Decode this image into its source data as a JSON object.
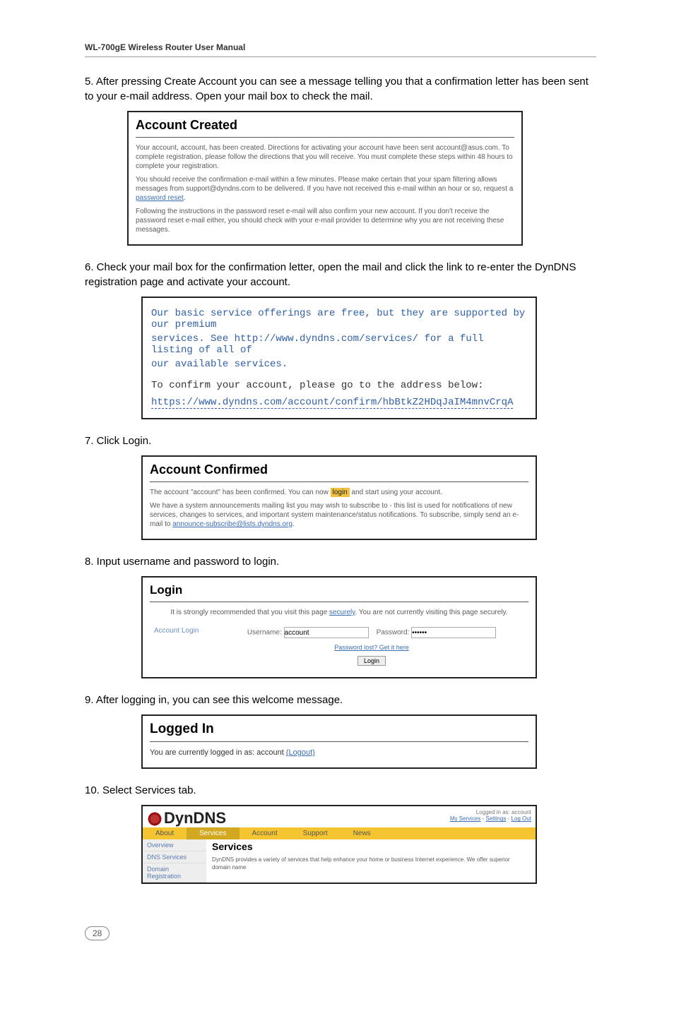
{
  "header": {
    "title": "WL-700gE Wireless Router User Manual"
  },
  "steps": {
    "s5": "5. After pressing Create Account you can see a message telling you that a confirmation letter has been sent to your e-mail address.  Open your mail box to check the mail.",
    "s6": "6. Check your mail box for the confirmation letter, open the mail and click the link to re-enter the DynDNS registration page and activate your account.",
    "s7": "7. Click Login.",
    "s8": " 8. Input username and password to login.",
    "s9": "9. After logging in, you can see this welcome message.",
    "s10": "10. Select Services tab."
  },
  "shot_created": {
    "title": "Account Created",
    "p1": "Your account, account, has been created. Directions for activating your account have been sent account@asus.com. To complete registration, please follow the directions that you will receive. You must complete these steps within 48 hours to complete your registration.",
    "p2_a": "You should receive the confirmation e-mail within a few minutes. Please make certain that your spam filtering allows messages from support@dyndns.com to be delivered. If you have not received this e-mail within an hour or so, request a ",
    "p2_link": "password reset",
    "p3": "Following the instructions in the password reset e-mail will also confirm your new account. If you don't receive the password reset e-mail either, you should check with your e-mail provider to determine why you are not receiving these messages."
  },
  "shot_mail": {
    "l1": "Our basic service offerings are free, but they are supported by our premium",
    "l2": "services.  See http://www.dyndns.com/services/ for a full listing of all of",
    "l3": "our available services.",
    "l4": "To confirm your account, please go to the address below:",
    "l5": "https://www.dyndns.com/account/confirm/hbBtkZ2HDqJaIM4mnvCrqA"
  },
  "shot_confirmed": {
    "title": "Account Confirmed",
    "line_a": "The account \"account\" has been confirmed. You can now ",
    "line_link": "login",
    "line_b": " and start using your account.",
    "p2": "We have a system announcements mailing list you may wish to subscribe to - this list is used for notifications of new services, changes to services, and important system maintenance/status notifications. To subscribe, simply send an e-mail to ",
    "p2_link": "announce-subscribe@lists.dyndns.org"
  },
  "shot_login": {
    "title": "Login",
    "note_a": "It is strongly recommended that you visit this page ",
    "note_link": "securely",
    "note_b": ". You are not currently visiting this page securely.",
    "sidebar": "Account Login",
    "user_label": "Username:",
    "user_value": "account",
    "pass_label": "Password:",
    "pass_value": "******",
    "forgot": "Password lost? Get it here",
    "btn": "Login"
  },
  "shot_loggedin": {
    "title": "Logged In",
    "msg_a": "You are currently logged in as: account ",
    "msg_link": "(Logout)"
  },
  "shot_dyndns": {
    "logo": "DynDNS",
    "top_right_a": "Logged in as: account",
    "top_right_b": "My Services - Settings - Log Out",
    "tabs": {
      "about": "About",
      "services": "Services",
      "account": "Account",
      "support": "Support",
      "news": "News"
    },
    "side": {
      "a": "Overview",
      "b": "DNS Services",
      "c": "Domain Registration"
    },
    "h": "Services",
    "body": "DynDNS provides a variety of services that help enhance your home or business Internet experience. We offer superior domain name"
  },
  "pagenum": "28"
}
